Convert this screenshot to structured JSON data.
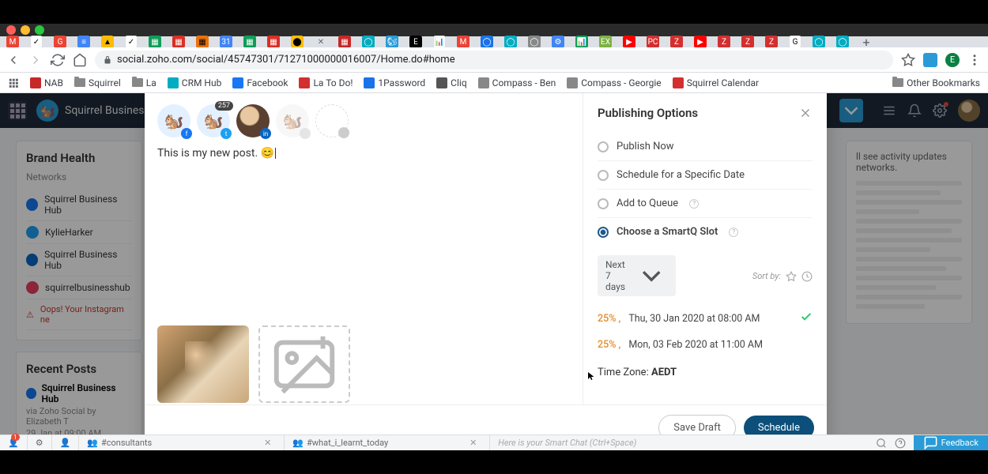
{
  "browser": {
    "url": "social.zoho.com/social/45747301/71271000000016007/Home.do#home",
    "bookmarks": [
      "NAB",
      "Squirrel",
      "La",
      "CRM Hub",
      "Facebook",
      "La To Do!",
      "1Password",
      "Cliq",
      "Compass - Ben",
      "Compass - Georgie",
      "Squirrel Calendar"
    ],
    "other_bookmarks": "Other Bookmarks"
  },
  "app": {
    "brand": "Squirrel Busines..."
  },
  "left": {
    "brand_health": "Brand Health",
    "networks_label": "Networks",
    "networks": [
      {
        "name": "Squirrel Business Hub",
        "net": "fb"
      },
      {
        "name": "KylieHarker",
        "net": "tw"
      },
      {
        "name": "Squirrel Business Hub",
        "net": "li"
      },
      {
        "name": "squirrelbusinesshub",
        "net": "ig"
      }
    ],
    "warning": "Oops! Your Instagram ne",
    "recent_posts": "Recent Posts",
    "recent1_title": "Squirrel Business Hub",
    "recent1_sub": "via Zoho Social by Elizabeth T",
    "recent1_time": "29 Jan at 09:00 AM"
  },
  "compose": {
    "badge": "257",
    "text": "This is my new post. 😊"
  },
  "publish": {
    "title": "Publishing Options",
    "opt1": "Publish Now",
    "opt2": "Schedule for a Specific Date",
    "opt3": "Add to Queue",
    "opt4": "Choose a SmartQ Slot",
    "range": "Next 7 days",
    "sortby": "Sort by:",
    "slots": [
      {
        "pct": "25% ,",
        "time": "Thu, 30 Jan 2020 at 08:00 AM",
        "selected": true
      },
      {
        "pct": "25% ,",
        "time": "Mon, 03 Feb 2020 at 11:00 AM",
        "selected": false
      }
    ],
    "tz_label": "Time Zone: ",
    "tz_value": "AEDT",
    "save_draft": "Save Draft",
    "schedule": "Schedule"
  },
  "right": {
    "text": "ll see activity updates networks."
  },
  "bottom": {
    "tag1": "#consultants",
    "tag2": "#what_i_learnt_today",
    "smartchat": "Here is your Smart Chat (Ctrl+Space)",
    "feedback": "Feedback"
  }
}
